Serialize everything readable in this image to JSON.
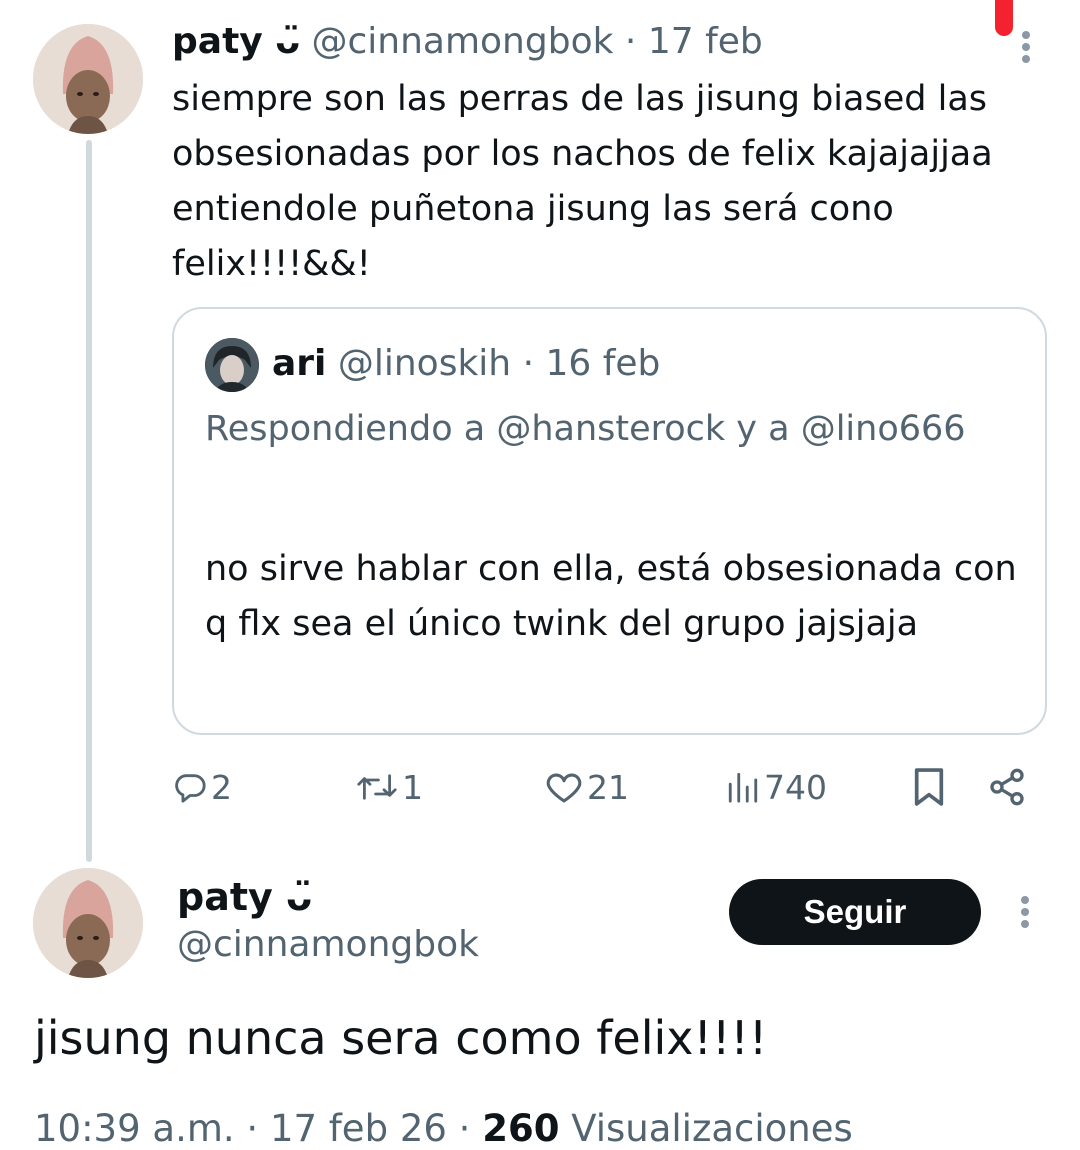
{
  "tweet": {
    "author_name": "paty ᴗ̈",
    "author_handle": "@cinnamongbok",
    "separator": "·",
    "date": "17 feb",
    "text": "siempre son las perras de las jisung biased las obsesionadas por los nachos de felix kajajajjaa entiendole puñetona jisung las será cono felix!!!!&&!"
  },
  "quote": {
    "author_name": "ari",
    "author_handle": "@linoskih",
    "separator": "·",
    "date": "16 feb",
    "replying_to": "Respondiendo a @hansterock y a @lino666",
    "text": "no sirve hablar con ella, está obsesionada con q flx sea el único twink del grupo jajsjaja"
  },
  "actions": {
    "replies": "2",
    "retweets": "1",
    "likes": "21",
    "views": "740"
  },
  "reply": {
    "author_name": "paty ᴗ̈",
    "author_handle": "@cinnamongbok",
    "follow_label": "Seguir",
    "text": "jisung nunca sera como felix!!!!",
    "time": "10:39 a.m.",
    "separator": "·",
    "date": "17 feb 26",
    "views_count": "260",
    "views_label": "Visualizaciones"
  },
  "colors": {
    "text_primary": "#0f1419",
    "text_secondary": "#536471",
    "border": "#cfd9de",
    "button_bg": "#0f1419",
    "indicator": "#f4212e"
  },
  "icons": [
    "reply-icon",
    "retweet-icon",
    "like-icon",
    "views-icon",
    "bookmark-icon",
    "share-icon",
    "more-icon"
  ]
}
